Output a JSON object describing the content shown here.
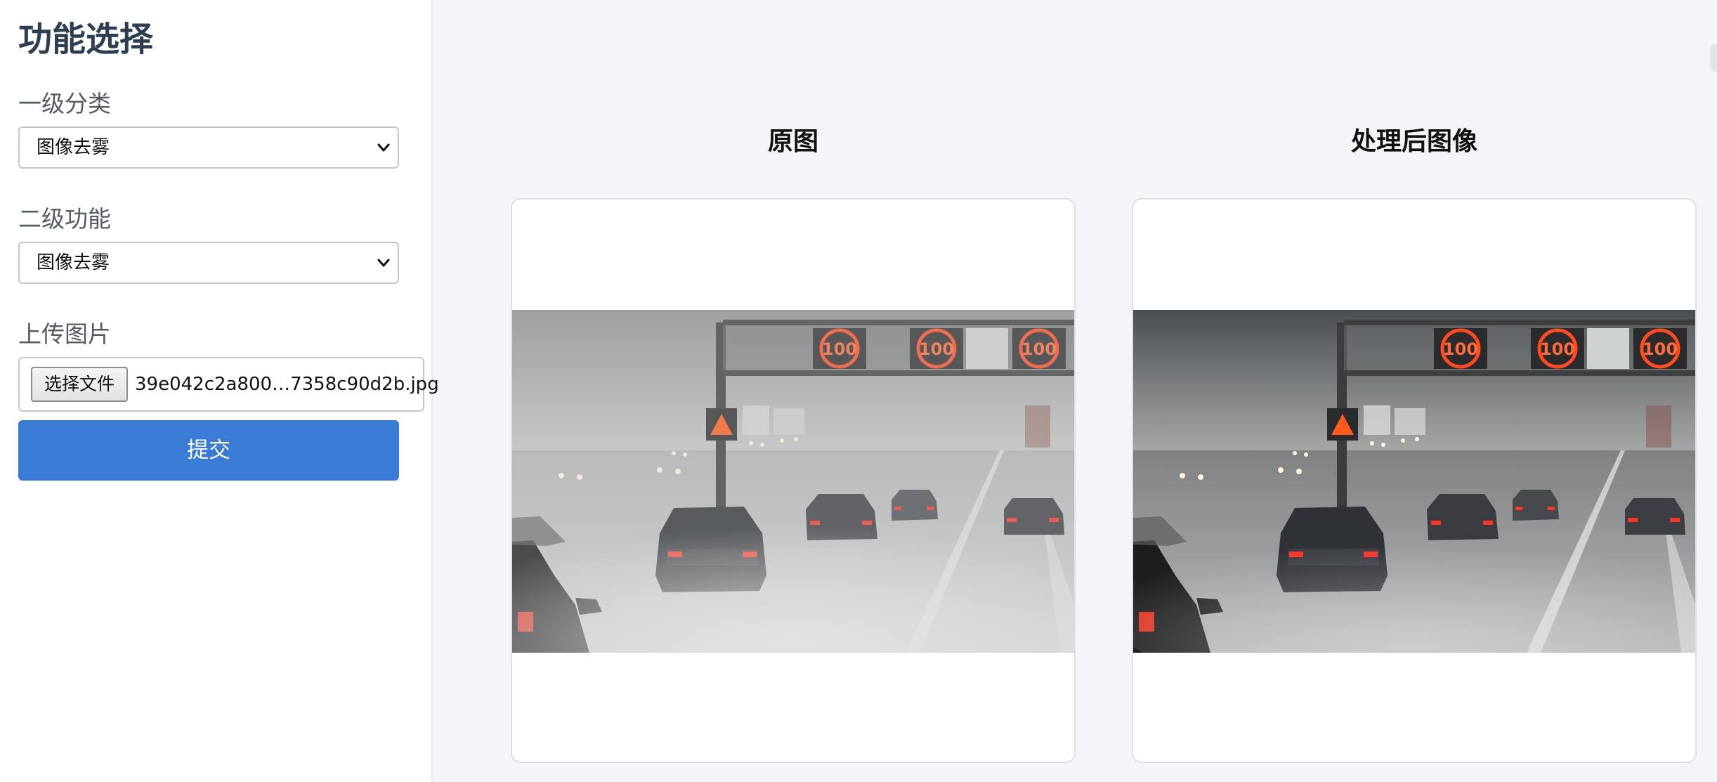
{
  "sidebar": {
    "title": "功能选择",
    "level1": {
      "label": "一级分类",
      "value": "图像去雾"
    },
    "level2": {
      "label": "二级功能",
      "value": "图像去雾"
    },
    "upload": {
      "label": "上传图片",
      "button_label": "选择文件",
      "file_name": "39e042c2a800…7358c90d2b.jpg"
    },
    "submit_label": "提交"
  },
  "main": {
    "original_title": "原图",
    "processed_title": "处理后图像"
  },
  "colors": {
    "accent": "#3a7bd5",
    "title_text": "#2c3e50",
    "background": "#f4f5f8",
    "sign_red": "#ff4a22"
  },
  "icons": {
    "select_arrow": "chevron-down-icon"
  }
}
